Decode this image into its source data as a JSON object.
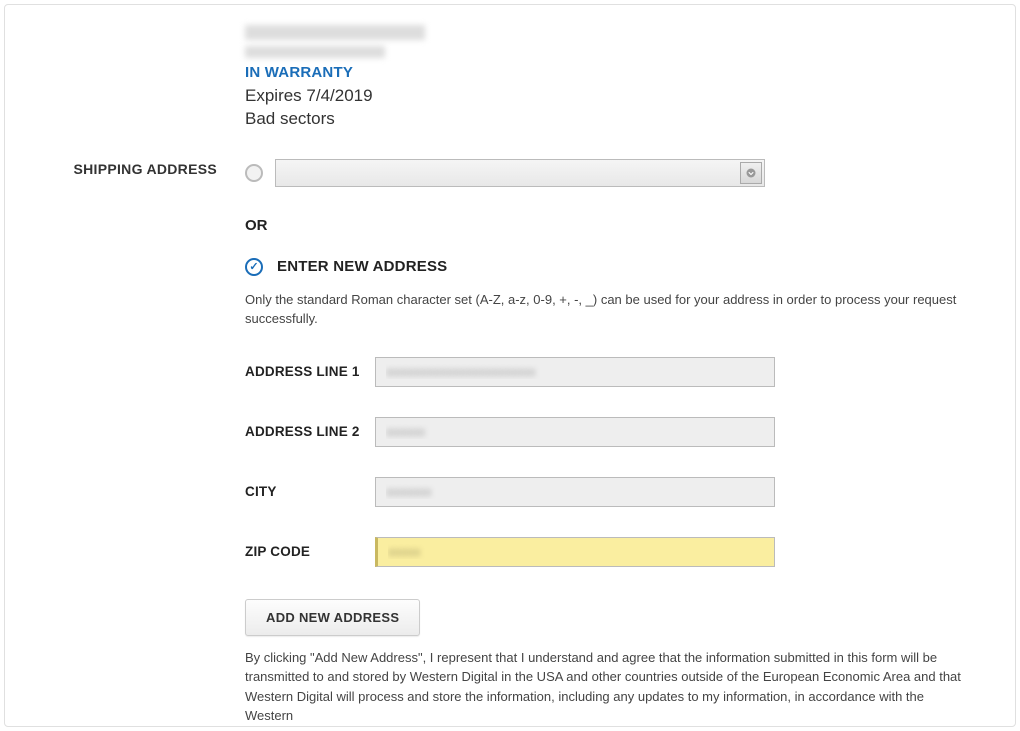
{
  "product": {
    "warranty_status": "IN WARRANTY",
    "expires_text": "Expires 7/4/2019",
    "reason_text": "Bad sectors"
  },
  "sections": {
    "shipping_label": "SHIPPING ADDRESS"
  },
  "address_picker": {
    "or_label": "OR",
    "enter_new_label": "ENTER NEW ADDRESS",
    "helper_text": "Only the standard Roman character set (A-Z, a-z, 0-9, +, -, _) can be used for your address in order to process your request successfully."
  },
  "fields": {
    "address_line_1": {
      "label": "ADDRESS LINE 1",
      "value": "xxxxxxxxxxxxxxxxxxxxxxx"
    },
    "address_line_2": {
      "label": "ADDRESS LINE 2",
      "value": "xxxxxx"
    },
    "city": {
      "label": "CITY",
      "value": "xxxxxxx"
    },
    "zip": {
      "label": "ZIP CODE",
      "value": "xxxxx"
    }
  },
  "actions": {
    "add_button": "ADD NEW ADDRESS"
  },
  "legal": {
    "text": "By clicking \"Add New Address\", I represent that I understand and agree that the information submitted in this form will be transmitted to and stored by Western Digital in the USA and other countries outside of the European Economic Area and that Western Digital will process and store the information, including any updates to my information, in accordance with the Western"
  }
}
